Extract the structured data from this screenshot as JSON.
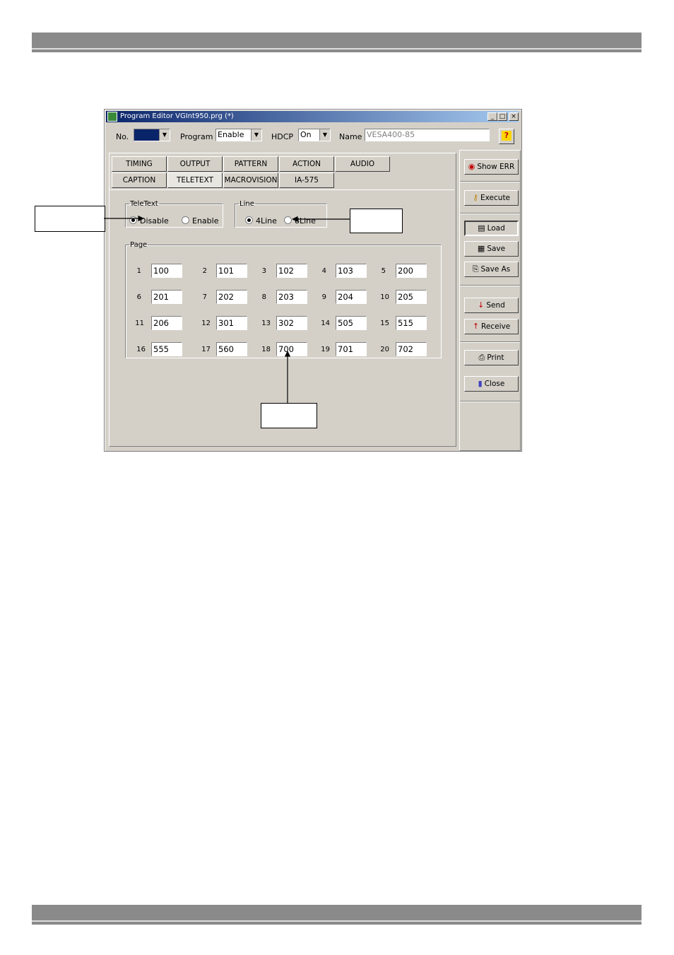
{
  "window": {
    "title": "Program Editor VGInt950.prg (*)",
    "min_glyph": "_",
    "max_glyph": "□",
    "close_glyph": "×"
  },
  "header": {
    "no_label": "No.",
    "no_value": "",
    "program_label": "Program",
    "program_value": "Enable",
    "hdcp_label": "HDCP",
    "hdcp_value": "On",
    "name_label": "Name",
    "name_value": "VESA400-85",
    "help_glyph": "?"
  },
  "tabs": {
    "row1": [
      "TIMING",
      "OUTPUT",
      "PATTERN",
      "ACTION",
      "AUDIO"
    ],
    "row2": [
      "CAPTION",
      "TELETEXT",
      "MACROVISION",
      "IA-575"
    ],
    "active": "TELETEXT"
  },
  "teletext": {
    "group_label": "TeleText",
    "options": [
      "Disable",
      "Enable"
    ],
    "selected": "Disable"
  },
  "line": {
    "group_label": "Line",
    "options": [
      "4Line",
      "8Line"
    ],
    "selected": "4Line"
  },
  "page": {
    "group_label": "Page",
    "numbers": [
      "1",
      "2",
      "3",
      "4",
      "5",
      "6",
      "7",
      "8",
      "9",
      "10",
      "11",
      "12",
      "13",
      "14",
      "15",
      "16",
      "17",
      "18",
      "19",
      "20"
    ],
    "values": [
      "100",
      "101",
      "102",
      "103",
      "200",
      "201",
      "202",
      "203",
      "204",
      "205",
      "206",
      "301",
      "302",
      "505",
      "515",
      "555",
      "560",
      "700",
      "701",
      "702"
    ]
  },
  "side": {
    "show_err": "Show ERR",
    "execute": "Execute",
    "load": "Load",
    "save": "Save",
    "save_as": "Save As",
    "send": "Send",
    "receive": "Receive",
    "print": "Print",
    "close": "Close"
  },
  "colors": {
    "window_bg": "#d4d0c8",
    "titlebar": "#0a246a",
    "page_bar": "#8a8a8a"
  }
}
